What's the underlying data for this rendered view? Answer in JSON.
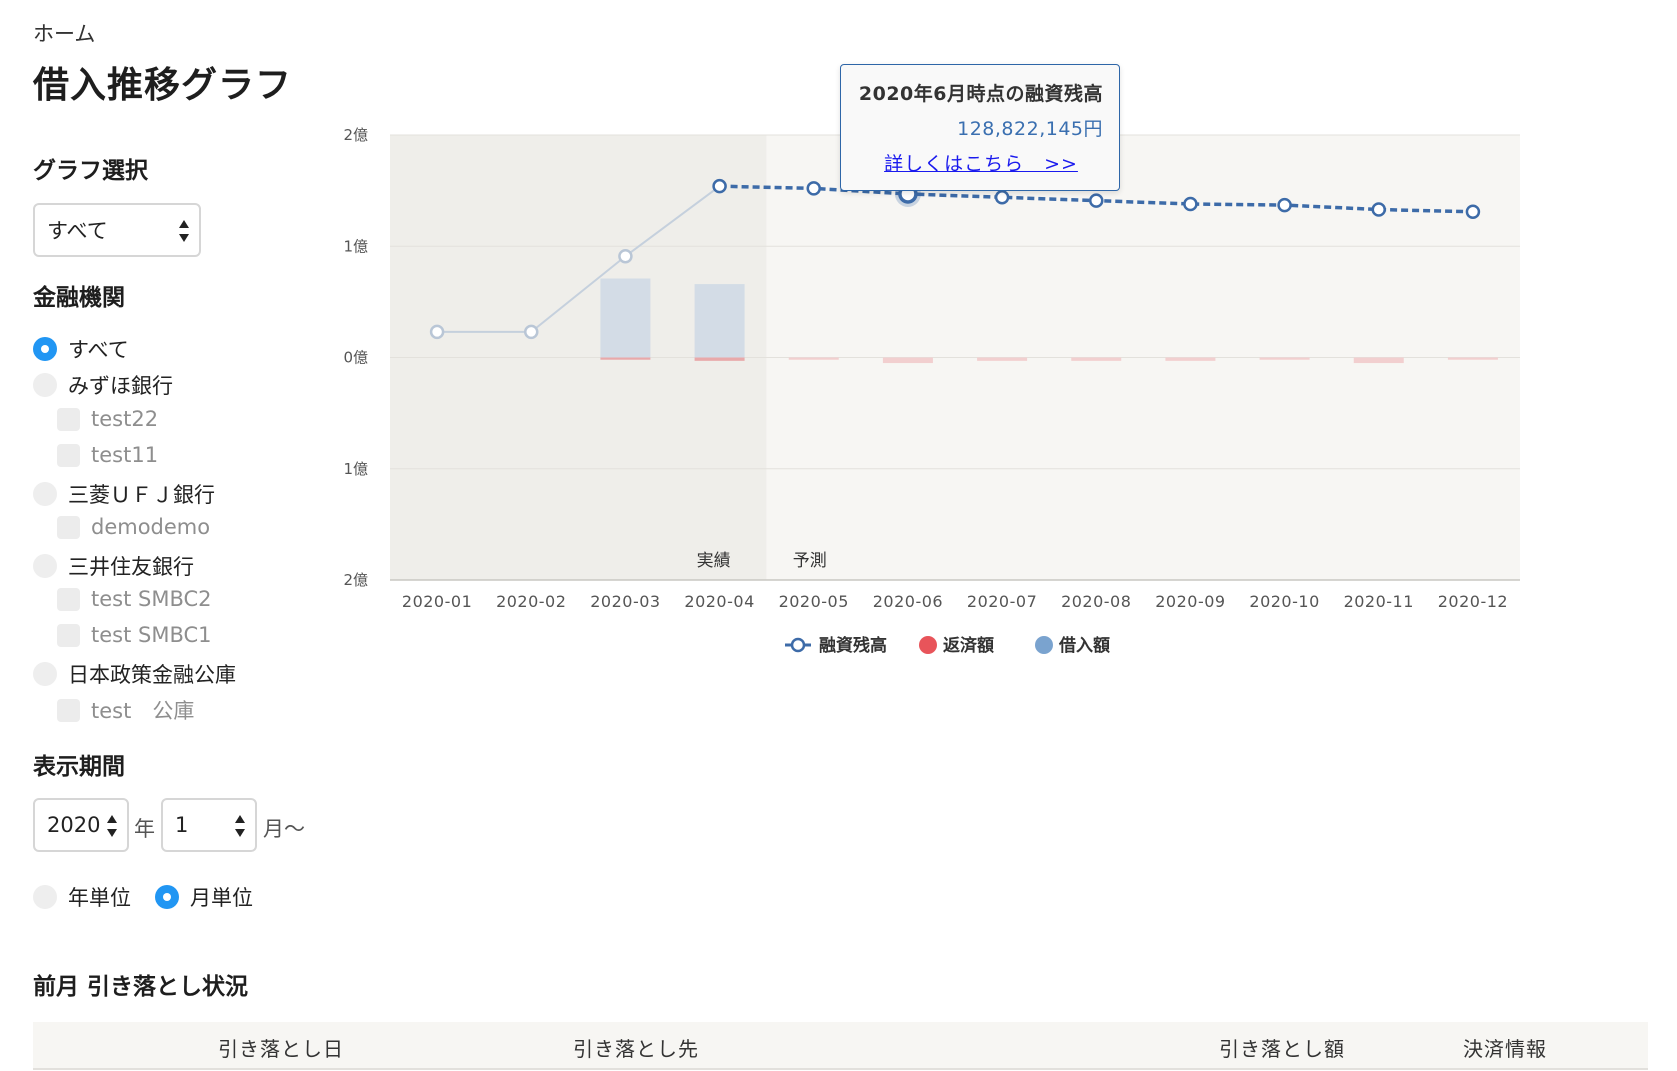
{
  "breadcrumb": "ホーム",
  "page_title": "借入推移グラフ",
  "graph_select": {
    "label": "グラフ選択",
    "value": "すべて"
  },
  "institutions": {
    "label": "金融機関",
    "items": [
      {
        "type": "radio",
        "label": "すべて",
        "selected": true
      },
      {
        "type": "radio",
        "label": "みずほ銀行",
        "selected": false
      },
      {
        "type": "checkbox",
        "label": "test22",
        "checked": false
      },
      {
        "type": "checkbox",
        "label": "test11",
        "checked": false
      },
      {
        "type": "radio",
        "label": "三菱ＵＦＪ銀行",
        "selected": false
      },
      {
        "type": "checkbox",
        "label": "demodemo",
        "checked": false
      },
      {
        "type": "radio",
        "label": "三井住友銀行",
        "selected": false
      },
      {
        "type": "checkbox",
        "label": "test SMBC2",
        "checked": false
      },
      {
        "type": "checkbox",
        "label": "test SMBC1",
        "checked": false
      },
      {
        "type": "radio",
        "label": "日本政策金融公庫",
        "selected": false
      },
      {
        "type": "checkbox",
        "label": "test　公庫",
        "checked": false
      }
    ]
  },
  "period": {
    "label": "表示期間",
    "year_value": "2020",
    "year_unit": "年",
    "month_value": "1",
    "month_unit": "月〜",
    "unit_options": [
      {
        "label": "年単位",
        "selected": false
      },
      {
        "label": "月単位",
        "selected": true
      }
    ]
  },
  "tooltip": {
    "title": "2020年6月時点の融資残高",
    "value": "128,822,145円",
    "link": "詳しくはこちら　>>"
  },
  "chart_data": {
    "type": "line",
    "categories": [
      "2020-01",
      "2020-02",
      "2020-03",
      "2020-04",
      "2020-05",
      "2020-06",
      "2020-07",
      "2020-08",
      "2020-09",
      "2020-10",
      "2020-11",
      "2020-12"
    ],
    "y_ticks": [
      "2億",
      "1億",
      "0億",
      "1億",
      "2億"
    ],
    "ylim": [
      -2,
      2
    ],
    "y_unit": "億",
    "bands": [
      {
        "label": "実績",
        "from": "2020-01",
        "to": "2020-04"
      },
      {
        "label": "予測",
        "from": "2020-05",
        "to": "2020-12"
      }
    ],
    "highlight_index": 5,
    "series": [
      {
        "name": "融資残高",
        "type": "line",
        "color": "#3d6ba8",
        "values": [
          0.23,
          0.23,
          0.91,
          1.54,
          1.52,
          1.47,
          1.44,
          1.41,
          1.38,
          1.37,
          1.33,
          1.31
        ]
      },
      {
        "name": "返済額",
        "type": "bar",
        "color": "#e8545a",
        "values": [
          0,
          0,
          -0.02,
          -0.03,
          -0.02,
          -0.05,
          -0.03,
          -0.03,
          -0.03,
          -0.02,
          -0.05,
          -0.02
        ]
      },
      {
        "name": "借入額",
        "type": "bar",
        "color": "#7aa3cf",
        "values": [
          0,
          0,
          0.71,
          0.66,
          0,
          0,
          0,
          0,
          0,
          0,
          0,
          0
        ]
      }
    ]
  },
  "withdrawal": {
    "title": "前月 引き落とし状況",
    "headers": [
      "引き落とし日",
      "引き落とし先",
      "引き落とし額",
      "決済情報"
    ]
  }
}
